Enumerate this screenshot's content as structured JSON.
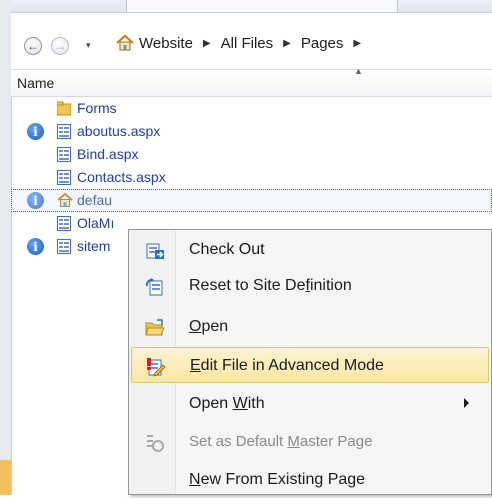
{
  "nav": {
    "back_glyph": "←",
    "forward_glyph": "→",
    "dropdown_glyph": "▾",
    "separator_glyph": "▶",
    "breadcrumbs": [
      "Website",
      "All Files",
      "Pages"
    ]
  },
  "list": {
    "column_header": "Name",
    "rows": [
      {
        "name": "Forms",
        "icon": "folder-icon",
        "info": false
      },
      {
        "name": "aboutus.aspx",
        "icon": "aspx-page-icon",
        "info": true
      },
      {
        "name": "Bind.aspx",
        "icon": "aspx-page-icon",
        "info": false
      },
      {
        "name": "Contacts.aspx",
        "icon": "aspx-page-icon",
        "info": false
      },
      {
        "name": "defau",
        "icon": "home-page-icon",
        "info": true,
        "selected": true
      },
      {
        "name": "OlaMı",
        "icon": "aspx-page-icon",
        "info": false
      },
      {
        "name": "sitem",
        "icon": "aspx-page-icon",
        "info": true
      }
    ]
  },
  "context_menu": {
    "items": [
      {
        "pre": "",
        "ul": "",
        "post": "Check Out",
        "icon": "check-out-icon"
      },
      {
        "pre": "Reset to Site De",
        "ul": "f",
        "post": "inition",
        "icon": "reset-site-definition-icon"
      },
      {
        "pre": "",
        "ul": "O",
        "post": "pen",
        "icon": "open-folder-icon"
      },
      {
        "pre": "",
        "ul": "E",
        "post": "dit File in Advanced Mode",
        "icon": "edit-advanced-icon",
        "highlighted": true
      },
      {
        "pre": "Open ",
        "ul": "W",
        "post": "ith",
        "icon": "",
        "submenu": true
      },
      {
        "pre": "Set as Default ",
        "ul": "M",
        "post": "aster Page",
        "icon": "set-default-master-icon",
        "disabled": true
      },
      {
        "pre": "",
        "ul": "N",
        "post": "ew From Existing Page",
        "icon": ""
      }
    ]
  },
  "colors": {
    "link_blue": "#1f3f9f",
    "highlight_fill": "#fbe7a4",
    "highlight_border": "#e5c365"
  }
}
